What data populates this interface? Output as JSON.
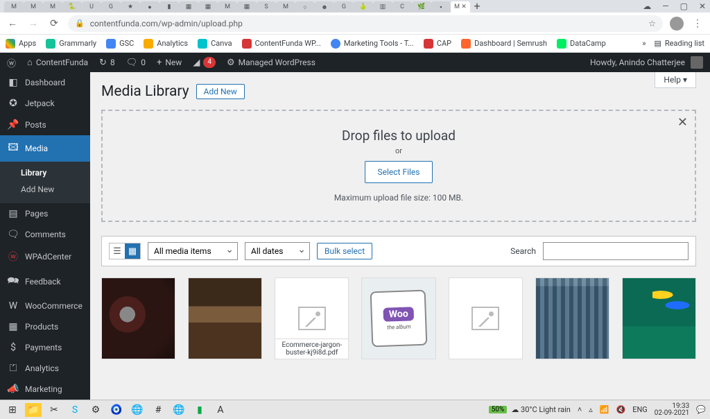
{
  "browser": {
    "url": "contentfunda.com/wp-admin/upload.php",
    "active_tab": "Media Library",
    "add_tab": "+",
    "window_icons": [
      "☁",
      "—",
      "▢",
      "✕"
    ],
    "nav_back": "←",
    "nav_fwd": "→",
    "nav_reload": "⟳",
    "lock": "🔒",
    "star": "☆",
    "menu": "⋮"
  },
  "bookmarks": [
    {
      "label": "Apps",
      "color": "#ea4335"
    },
    {
      "label": "Grammarly",
      "color": "#15c39a"
    },
    {
      "label": "GSC",
      "color": "#4285f4"
    },
    {
      "label": "Analytics",
      "color": "#f9ab00"
    },
    {
      "label": "Canva",
      "color": "#00c4cc"
    },
    {
      "label": "ContentFunda WP...",
      "color": "#d63638"
    },
    {
      "label": "Marketing Tools - T...",
      "color": "#4285f4"
    },
    {
      "label": "CAP",
      "color": "#d63638"
    },
    {
      "label": "Dashboard | Semrush",
      "color": "#ff642d"
    },
    {
      "label": "DataCamp",
      "color": "#03ef62"
    }
  ],
  "bookmarks_more": "»",
  "bookmarks_reading": "Reading list",
  "wpbar": {
    "site": "ContentFunda",
    "updates": "8",
    "comments": "0",
    "new": "New",
    "yoast_cnt": "4",
    "managed": "Managed WordPress",
    "howdy": "Howdy, Anindo Chatterjee"
  },
  "menu": [
    {
      "icon": "◧",
      "label": "Dashboard"
    },
    {
      "icon": "✪",
      "label": "Jetpack"
    },
    {
      "icon": "",
      "label": ""
    },
    {
      "icon": "✎",
      "label": "Posts"
    },
    {
      "icon": "▣",
      "label": "Media",
      "current": true,
      "sub": [
        {
          "label": "Library",
          "active": true
        },
        {
          "label": "Add New"
        }
      ]
    },
    {
      "icon": "▤",
      "label": "Pages"
    },
    {
      "icon": "🗨",
      "label": "Comments"
    },
    {
      "icon": "wp",
      "label": "WPAdCenter"
    },
    {
      "icon": "🗪",
      "label": "Feedback"
    },
    {
      "icon": "",
      "label": ""
    },
    {
      "icon": "W",
      "label": "WooCommerce"
    },
    {
      "icon": "▦",
      "label": "Products"
    },
    {
      "icon": "$",
      "label": "Payments"
    },
    {
      "icon": "⏍",
      "label": "Analytics"
    },
    {
      "icon": "📣",
      "label": "Marketing"
    }
  ],
  "page": {
    "title": "Media Library",
    "add_new": "Add New",
    "help": "Help ▾",
    "drop_heading": "Drop files to upload",
    "drop_or": "or",
    "select_files": "Select Files",
    "max": "Maximum upload file size: 100 MB.",
    "close": "✕"
  },
  "filters": {
    "type": "All media items",
    "date": "All dates",
    "bulk": "Bulk select",
    "search_label": "Search",
    "search_value": ""
  },
  "thumbs": {
    "pdf_caption": "Ecommerce-jargon-buster-kj9i8d.pdf",
    "woo_label": "Woo",
    "woo_sub": "the album"
  },
  "taskbar": {
    "battery": "50%",
    "weather": "30°C  Light rain",
    "lang": "ENG",
    "time": "19:33",
    "date": "02-09-2021"
  }
}
